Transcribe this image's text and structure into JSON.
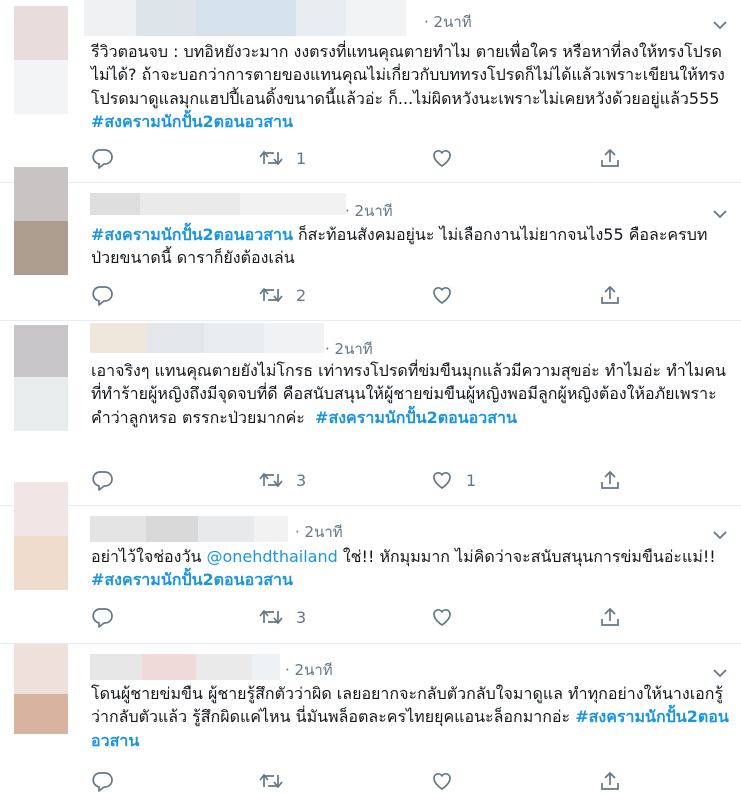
{
  "tweets": [
    {
      "time": "· 2นาที",
      "segments": [
        {
          "type": "text",
          "text": "รีวิวตอนจบ : บทอิหยังวะมาก งงตรงที่แทนคุณตายทำไม ตายเพื่อใคร หรือหาที่ลงให้ทรงโปรดไม่ได้? ถ้าจะบอกว่าการตายของแทนคุณไม่เกี่ยวกับบททรงโปรดก็ไม่ได้แล้วเพราะเขียนให้ทรงโปรดมาดูแลมุกแฮปปี้เอนดิ้งขนาดนี้แล้วอ่ะ ก็...ไม่ผิดหวังนะเพราะไม่เคยหวังด้วยอยู่แล้ว555 "
        },
        {
          "type": "hashtag",
          "text": "#สงครามนักปั้น2ตอนอวสาน"
        }
      ],
      "retweets": "1",
      "likes": ""
    },
    {
      "time": "· 2นาที",
      "segments": [
        {
          "type": "hashtag",
          "text": "#สงครามนักปั้น2ตอนอวสาน"
        },
        {
          "type": "text",
          "text": " ก็สะท้อนสังคมอยู่นะ ไม่เลือกงานไม่ยากจนไง55 คือละครบทป่วยขนาดนี้ ดาราก็ยังต้องเล่น"
        }
      ],
      "retweets": "2",
      "likes": ""
    },
    {
      "time": "· 2นาที",
      "segments": [
        {
          "type": "text",
          "text": "เอาจริงๆ แทนคุณตายยังไม่โกรธ เท่าทรงโปรดที่ข่มขืนมุกแล้วมีความสุขอ่ะ ทำไมอ่ะ ทำไมคนที่ทำร้ายผู้หญิงถึงมีจุดจบที่ดี คือสนับสนุนให้ผู้ชายข่มขืนผู้หญิงพอมีลูกผู้หญิงต้องให้อภัยเพราะคำว่าลูกหรอ ตรรกะป่วยมากค่ะ  "
        },
        {
          "type": "hashtag",
          "text": "#สงครามนักปั้น2ตอนอวสาน"
        }
      ],
      "retweets": "3",
      "likes": "1"
    },
    {
      "time": "· 2นาที",
      "segments": [
        {
          "type": "text",
          "text": "อย่าไว้ใจช่องวัน "
        },
        {
          "type": "mention",
          "text": "@onehdthailand"
        },
        {
          "type": "text",
          "text": " ใช่!! หักมุมมาก ไม่คิดว่าจะสนับสนุนการข่มขืนอ่ะแม่!! "
        },
        {
          "type": "hashtag",
          "text": "#สงครามนักปั้น2ตอนอวสาน"
        }
      ],
      "retweets": "3",
      "likes": ""
    },
    {
      "time": "· 2นาที",
      "segments": [
        {
          "type": "text",
          "text": "โดนผู้ชายข่มขืน ผู้ชายรู้สึกตัวว่าผิด เลยอยากจะกลับตัวกลับใจมาดูแล ทำทุกอย่างให้นางเอกรู้ว่ากลับตัวแล้ว รู้สึกผิดแค่ไหน นี่มันพล็อตละครไทยยุคแอนะล็อกมากอ่ะ "
        },
        {
          "type": "hashtag",
          "text": "#สงครามนักปั้น2ตอนอวสาน"
        }
      ],
      "retweets": "",
      "likes": ""
    }
  ],
  "icons": {
    "reply": "reply-icon",
    "retweet": "retweet-icon",
    "like": "heart-icon",
    "share": "share-icon",
    "menu": "chevron-down-icon"
  },
  "colors": {
    "hashtag": "#1b95e0",
    "muted": "#657786",
    "divider": "#e6ecf0"
  }
}
